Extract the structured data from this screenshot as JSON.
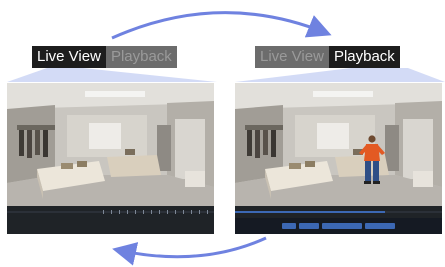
{
  "left_panel": {
    "tabs": [
      {
        "label": "Live View",
        "active": true
      },
      {
        "label": "Playback",
        "active": false
      }
    ],
    "scene": "camera-feed-retail-store"
  },
  "right_panel": {
    "tabs": [
      {
        "label": "Live View",
        "active": false
      },
      {
        "label": "Playback",
        "active": true
      }
    ],
    "scene": "playback-feed-retail-store-with-person"
  },
  "colors": {
    "arrow": "#6f82e0",
    "fan": "#c8d2f4",
    "tab_bg": "#1d1d1d",
    "tab_dim_bg": "#6c6c6c",
    "control_accent": "#3c68b4"
  },
  "icons": [
    "curved-arrow-top-icon",
    "curved-arrow-bottom-icon"
  ]
}
